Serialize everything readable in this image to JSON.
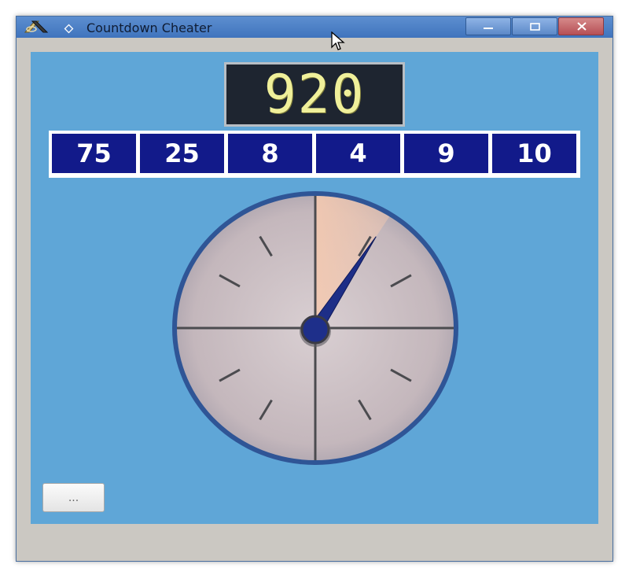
{
  "window": {
    "title": "Countdown Cheater",
    "icons": {
      "app": "app-logo-icon",
      "menu": "window-menu-diamond-icon",
      "minimize": "minimize-icon",
      "maximize": "maximize-icon",
      "close": "close-icon"
    }
  },
  "target": {
    "value": "920"
  },
  "numbers": [
    "75",
    "25",
    "8",
    "4",
    "9",
    "10"
  ],
  "clock": {
    "hand_fraction_of_full_turn": 0.09,
    "colors": {
      "face": "#c9bec3",
      "rim": "#2f5596",
      "hand": "#1d2e87",
      "sweep": "#f2c4aa"
    }
  },
  "actions": {
    "more_label": "..."
  },
  "colors": {
    "background": "#5fa6d7",
    "tile": "#121a8a",
    "lcd_digits": "#f0f09a"
  }
}
